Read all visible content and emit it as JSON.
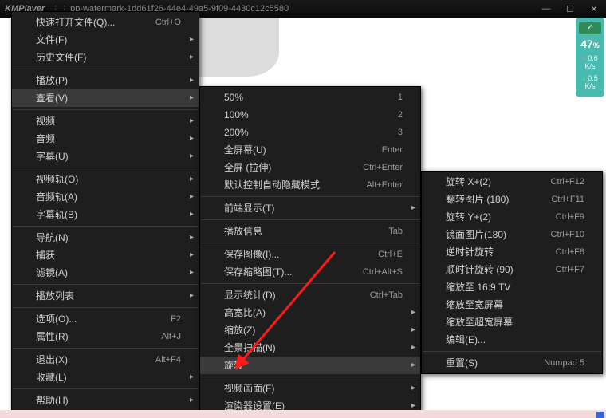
{
  "titlebar": {
    "app": "KMPlayer",
    "separator": "⋮⋮",
    "doc": "pp-watermark-1dd61f26-44e4-49a5-9f09-4430c12c5580",
    "min": "—",
    "max": "☐",
    "close": "✕"
  },
  "netwidget": {
    "check": "✓",
    "percent": "47",
    "percent_suffix": "%",
    "up_rate": "0.6",
    "dn_rate": "0.5",
    "unit": "K/s"
  },
  "menu1": [
    {
      "t": "item",
      "label": "快速打开文件(Q)...",
      "accel": "Ctrl+O"
    },
    {
      "t": "item",
      "label": "文件(F)",
      "sub": true
    },
    {
      "t": "item",
      "label": "历史文件(F)",
      "sub": true
    },
    {
      "t": "div"
    },
    {
      "t": "item",
      "label": "播放(P)",
      "sub": true
    },
    {
      "t": "item",
      "label": "查看(V)",
      "sub": true,
      "hl": true
    },
    {
      "t": "div"
    },
    {
      "t": "item",
      "label": "视频",
      "sub": true
    },
    {
      "t": "item",
      "label": "音频",
      "sub": true
    },
    {
      "t": "item",
      "label": "字幕(U)",
      "sub": true
    },
    {
      "t": "div"
    },
    {
      "t": "item",
      "label": "视频轨(O)",
      "sub": true
    },
    {
      "t": "item",
      "label": "音频轨(A)",
      "sub": true
    },
    {
      "t": "item",
      "label": "字幕轨(B)",
      "sub": true
    },
    {
      "t": "div"
    },
    {
      "t": "item",
      "label": "导航(N)",
      "sub": true
    },
    {
      "t": "item",
      "label": "捕获",
      "sub": true
    },
    {
      "t": "item",
      "label": "滤镜(A)",
      "sub": true
    },
    {
      "t": "div"
    },
    {
      "t": "item",
      "label": "播放列表",
      "sub": true
    },
    {
      "t": "div"
    },
    {
      "t": "item",
      "label": "选项(O)...",
      "accel": "F2"
    },
    {
      "t": "item",
      "label": "属性(R)",
      "accel": "Alt+J"
    },
    {
      "t": "div"
    },
    {
      "t": "item",
      "label": "退出(X)",
      "accel": "Alt+F4"
    },
    {
      "t": "item",
      "label": "收藏(L)",
      "sub": true
    },
    {
      "t": "div"
    },
    {
      "t": "item",
      "label": "帮助(H)",
      "sub": true
    }
  ],
  "menu2": [
    {
      "t": "item",
      "label": "50%",
      "accel": "1"
    },
    {
      "t": "item",
      "label": "100%",
      "accel": "2"
    },
    {
      "t": "item",
      "label": "200%",
      "accel": "3"
    },
    {
      "t": "item",
      "label": "全屏幕(U)",
      "accel": "Enter"
    },
    {
      "t": "item",
      "label": "全屏 (拉伸)",
      "accel": "Ctrl+Enter"
    },
    {
      "t": "item",
      "label": "默认控制自动隐藏模式",
      "accel": "Alt+Enter"
    },
    {
      "t": "div"
    },
    {
      "t": "item",
      "label": "前端显示(T)",
      "sub": true
    },
    {
      "t": "div"
    },
    {
      "t": "item",
      "label": "播放信息",
      "accel": "Tab"
    },
    {
      "t": "div"
    },
    {
      "t": "item",
      "label": "保存图像(I)...",
      "accel": "Ctrl+E"
    },
    {
      "t": "item",
      "label": "保存缩略图(T)...",
      "accel": "Ctrl+Alt+S"
    },
    {
      "t": "div"
    },
    {
      "t": "item",
      "label": "显示统计(D)",
      "accel": "Ctrl+Tab"
    },
    {
      "t": "item",
      "label": "高宽比(A)",
      "sub": true
    },
    {
      "t": "item",
      "label": "缩放(Z)",
      "sub": true
    },
    {
      "t": "item",
      "label": "全景扫描(N)",
      "sub": true
    },
    {
      "t": "item",
      "label": "旋转",
      "sub": true,
      "hl": true
    },
    {
      "t": "div"
    },
    {
      "t": "item",
      "label": "视频画面(F)",
      "sub": true
    },
    {
      "t": "item",
      "label": "渲染器设置(E)",
      "sub": true
    }
  ],
  "menu3": [
    {
      "t": "item",
      "label": "旋转 X+(2)",
      "accel": "Ctrl+F12"
    },
    {
      "t": "item",
      "label": "翻转图片  (180)",
      "accel": "Ctrl+F11"
    },
    {
      "t": "item",
      "label": "旋转 Y+(2)",
      "accel": "Ctrl+F9"
    },
    {
      "t": "item",
      "label": "镜面图片(180)",
      "accel": "Ctrl+F10"
    },
    {
      "t": "item",
      "label": "逆时针旋转",
      "accel": "Ctrl+F8"
    },
    {
      "t": "item",
      "label": "顺时针旋转  (90)",
      "accel": "Ctrl+F7"
    },
    {
      "t": "item",
      "label": "缩放至 16:9 TV"
    },
    {
      "t": "item",
      "label": "缩放至宽屏幕"
    },
    {
      "t": "item",
      "label": "缩放至超宽屏幕"
    },
    {
      "t": "item",
      "label": "编辑(E)..."
    },
    {
      "t": "div"
    },
    {
      "t": "item",
      "label": "重置(S)",
      "accel": "Numpad 5"
    }
  ]
}
